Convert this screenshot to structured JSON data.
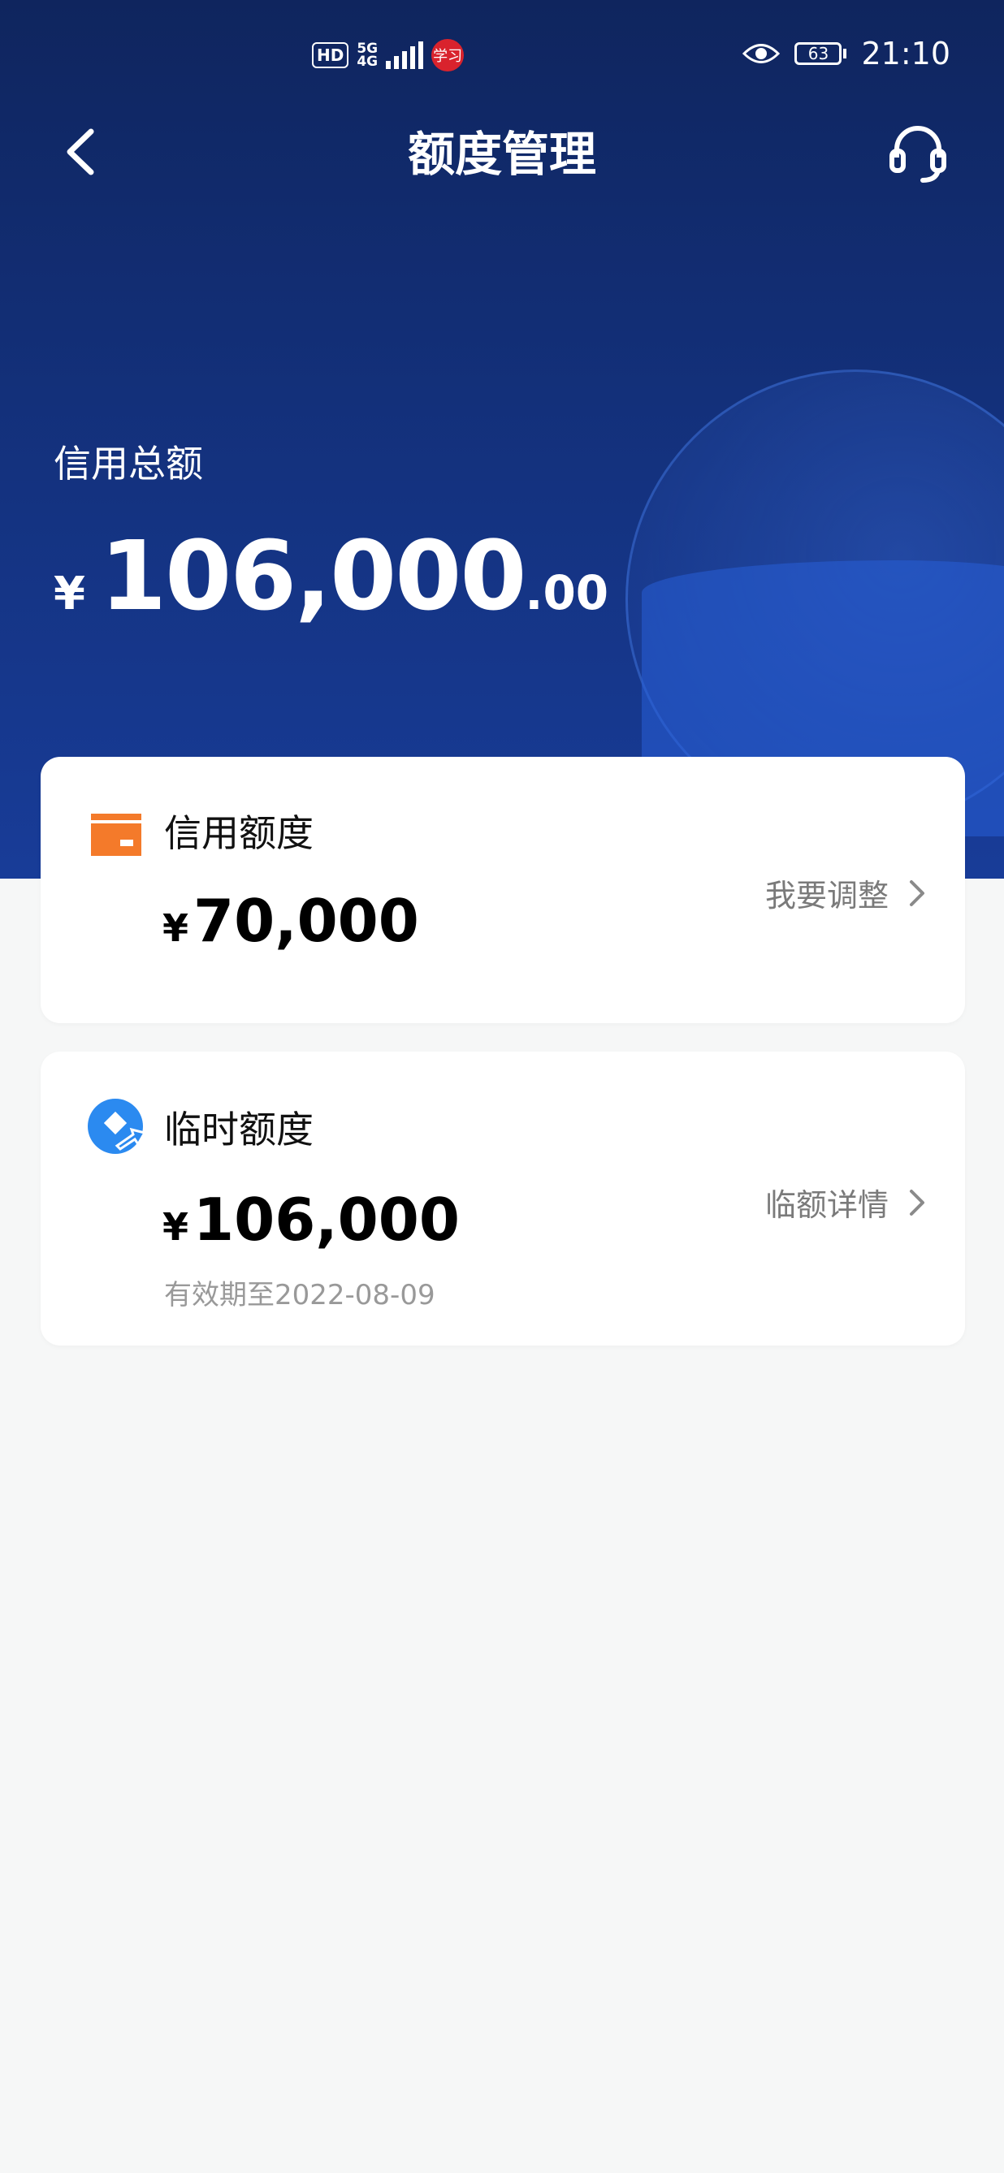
{
  "status_bar": {
    "hd_badge": "HD",
    "network": "5G",
    "network_sub": "4G",
    "app_badge": "学习",
    "battery": "63",
    "time": "21:10"
  },
  "header": {
    "title": "额度管理"
  },
  "total": {
    "label": "信用总额",
    "currency": "¥",
    "amount_integer": "106,000",
    "amount_decimal": ".00"
  },
  "credit_limit": {
    "title": "信用额度",
    "currency": "¥",
    "amount": "70,000",
    "action": "我要调整"
  },
  "temp_limit": {
    "title": "临时额度",
    "currency": "¥",
    "amount": "106,000",
    "validity": "有效期至2022-08-09",
    "action": "临额详情"
  },
  "colors": {
    "header_bg": "#13307a",
    "credit_icon": "#f47a2a",
    "temp_icon": "#2b8af0",
    "page_bg": "#f6f7f7"
  }
}
